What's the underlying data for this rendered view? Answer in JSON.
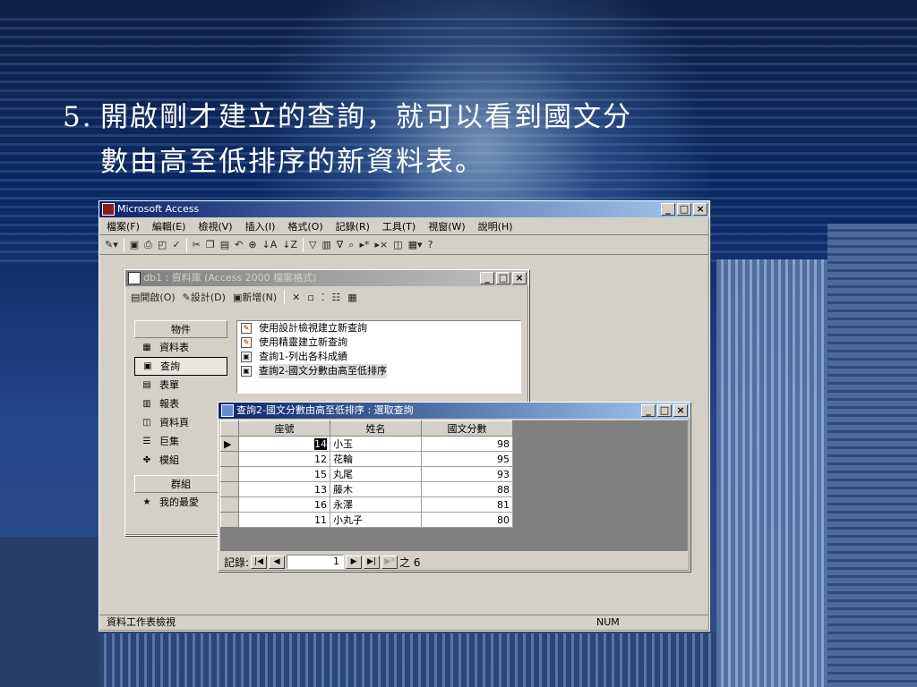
{
  "slide": {
    "number": "5.",
    "line1": "開啟剛才建立的查詢，就可以看到國文分",
    "line2": "數由高至低排序的新資料表。"
  },
  "app": {
    "title": "Microsoft Access",
    "menu": [
      "檔案(F)",
      "編輯(E)",
      "檢視(V)",
      "插入(I)",
      "格式(O)",
      "記錄(R)",
      "工具(T)",
      "視窗(W)",
      "說明(H)"
    ],
    "status_left": "資料工作表檢視",
    "status_num": "NUM"
  },
  "db": {
    "title": "db1 : 資料庫 (Access 2000 檔案格式)",
    "toolbar": {
      "open": "開啟(O)",
      "design": "設計(D)",
      "new": "新增(N)"
    },
    "objects_header": "物件",
    "objects": [
      {
        "label": "資料表",
        "icon": "table-icon"
      },
      {
        "label": "查詢",
        "icon": "query-icon"
      },
      {
        "label": "表單",
        "icon": "form-icon"
      },
      {
        "label": "報表",
        "icon": "report-icon"
      },
      {
        "label": "資料頁",
        "icon": "page-icon"
      },
      {
        "label": "巨集",
        "icon": "macro-icon"
      },
      {
        "label": "模組",
        "icon": "module-icon"
      }
    ],
    "groups_header": "群組",
    "favorites": "我的最愛",
    "items": [
      "使用設計檢視建立新查詢",
      "使用精靈建立新查詢",
      "查詢1-列出各科成績",
      "查詢2-國文分數由高至低排序"
    ]
  },
  "query": {
    "title": "查詢2-國文分數由高至低排序 : 選取查詢",
    "columns": [
      "座號",
      "姓名",
      "國文分數"
    ],
    "rows": [
      [
        "14",
        "小玉",
        "98"
      ],
      [
        "12",
        "花輪",
        "95"
      ],
      [
        "15",
        "丸尾",
        "93"
      ],
      [
        "13",
        "藤木",
        "88"
      ],
      [
        "16",
        "永澤",
        "81"
      ],
      [
        "11",
        "小丸子",
        "80"
      ]
    ],
    "nav": {
      "label": "記錄:",
      "current": "1",
      "total_label": "之 6"
    }
  }
}
